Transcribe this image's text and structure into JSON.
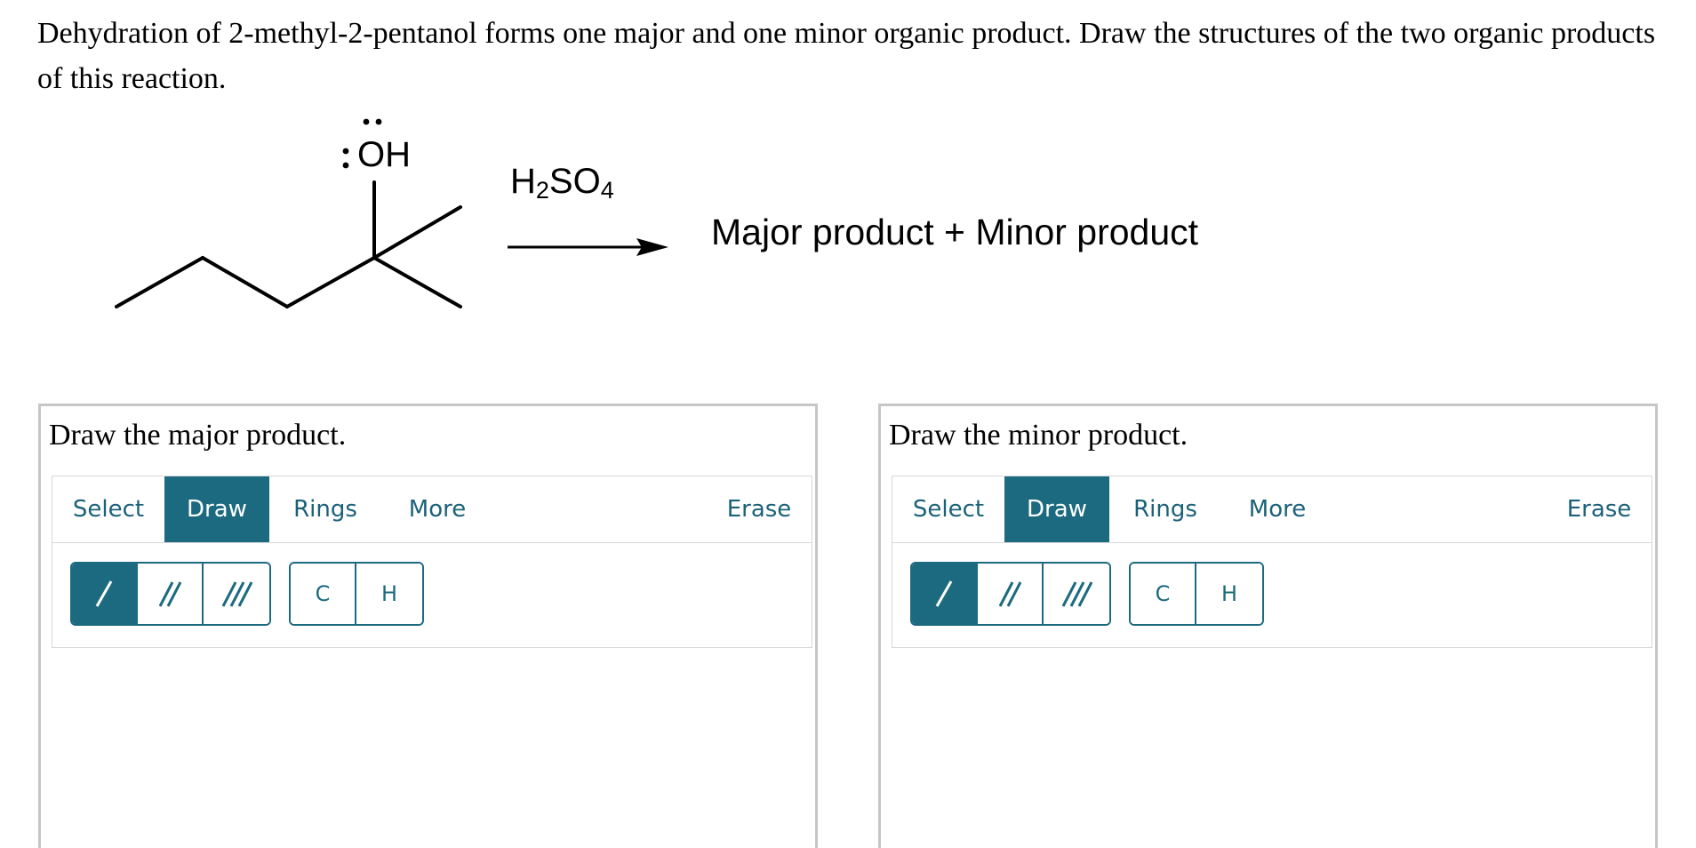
{
  "question": {
    "text": "Dehydration of 2-methyl-2-pentanol forms one major and one minor organic product. Draw the structures of the two organic products of this reaction."
  },
  "reaction": {
    "oh_label": "OH",
    "reagent": {
      "formula_parts": [
        "H",
        "2",
        "SO",
        "4"
      ]
    },
    "products_text": "Major product + Minor product"
  },
  "panels": [
    {
      "title": "Draw the major product.",
      "tabs": {
        "select": "Select",
        "draw": "Draw",
        "rings": "Rings",
        "more": "More",
        "erase": "Erase"
      },
      "atoms": {
        "c": "C",
        "h": "H"
      }
    },
    {
      "title": "Draw the minor product.",
      "tabs": {
        "select": "Select",
        "draw": "Draw",
        "rings": "Rings",
        "more": "More",
        "erase": "Erase"
      },
      "atoms": {
        "c": "C",
        "h": "H"
      }
    }
  ],
  "colors": {
    "accent": "#1c6a80",
    "tab_text": "#1b6179",
    "border": "#c6c6c6"
  }
}
